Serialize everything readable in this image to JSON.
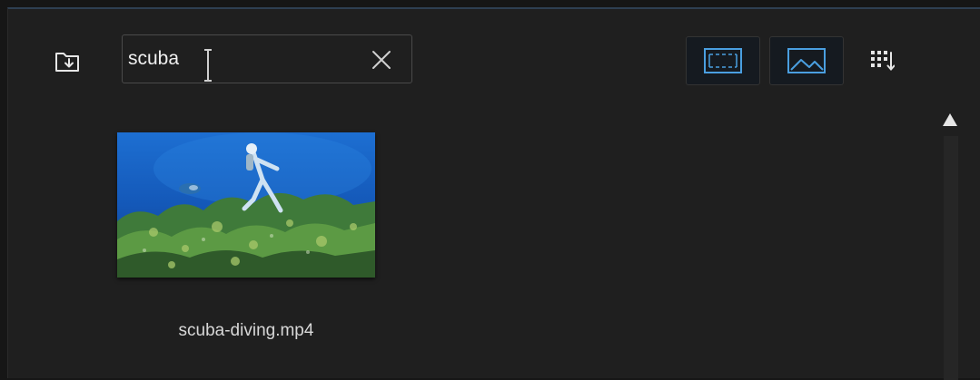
{
  "toolbar": {
    "import_icon": "folder-import-icon",
    "search": {
      "value": "scuba",
      "clear_icon": "close-icon"
    },
    "view_modes": [
      {
        "name": "video",
        "icon": "film-frame-icon",
        "active": false
      },
      {
        "name": "image",
        "icon": "image-landscape-icon",
        "active": true
      }
    ],
    "sort_icon": "grid-sort-icon"
  },
  "media": {
    "items": [
      {
        "filename": "scuba-diving.mp4",
        "thumbnail": "underwater-diver-reef"
      }
    ]
  },
  "colors": {
    "background": "#1f1f1f",
    "accent": "#4a9fe0",
    "text": "#d8d8d8"
  }
}
